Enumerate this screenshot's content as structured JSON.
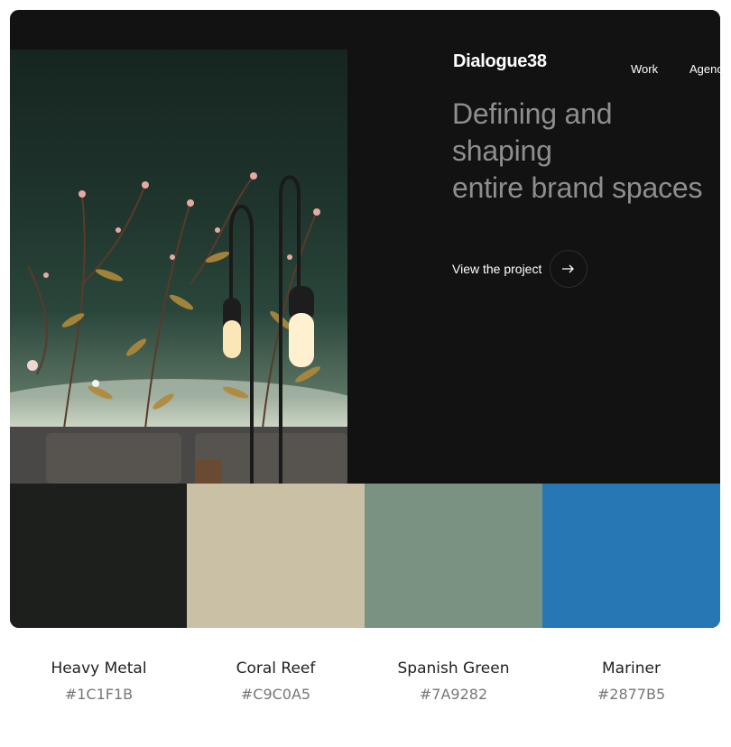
{
  "preview": {
    "brand": "Dialogue38",
    "nav": [
      "Work",
      "Agenc"
    ],
    "headline_lines": [
      "Defining and",
      "shaping",
      "entire brand spaces"
    ],
    "cta_label": "View the project",
    "cta_icon": "arrow-right-icon",
    "image_alt": "Floral wallpaper with pendant lamps above a sofa"
  },
  "palette": [
    {
      "name": "Heavy Metal",
      "hex": "#1C1F1B",
      "color": "#1C1F1B"
    },
    {
      "name": "Coral Reef",
      "hex": "#C9C0A5",
      "color": "#C9C0A5"
    },
    {
      "name": "Spanish Green",
      "hex": "#7A9282",
      "color": "#7A9282"
    },
    {
      "name": "Mariner",
      "hex": "#2877B5",
      "color": "#2877B5"
    }
  ]
}
